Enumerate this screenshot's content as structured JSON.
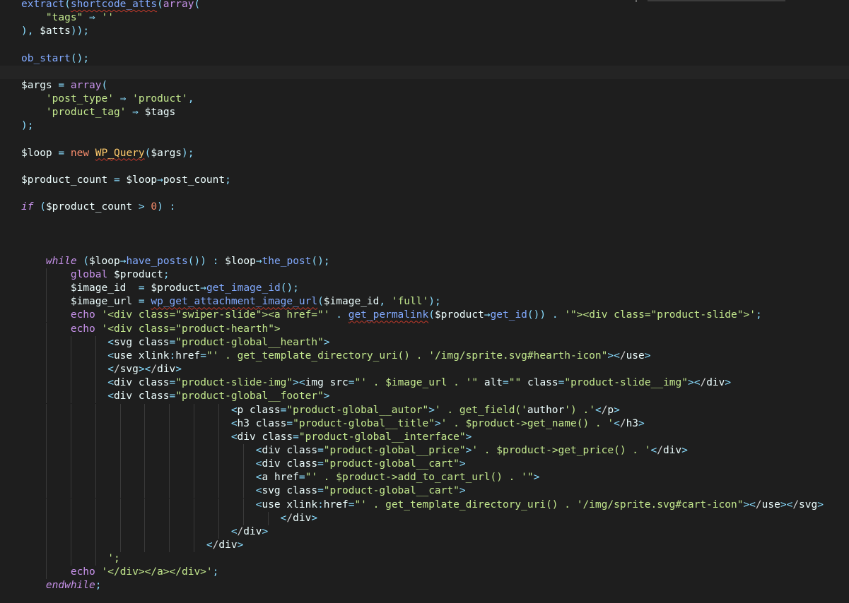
{
  "editor": {
    "language": "php",
    "lines": [
      "extract(shortcode_atts(array(",
      "    \"tags\" => ''",
      "), $atts));",
      "",
      "ob_start();",
      "",
      "$args = array(",
      "    'post_type' => 'product',",
      "    'product_tag' => $tags",
      ");",
      "",
      "$loop = new WP_Query($args);",
      "",
      "$product_count = $loop->post_count;",
      "",
      "if ($product_count > 0) :",
      "",
      "",
      "",
      "    while ($loop->have_posts()) : $loop->the_post();",
      "        global $product;",
      "        $image_id  = $product->get_image_id();",
      "        $image_url = wp_get_attachment_image_url($image_id, 'full');",
      "        echo '<div class=\"swiper-slide\"><a href=\"' . get_permalink($product->get_id()) . '\"><div class=\"product-slide\">';",
      "        echo '<div class=\"product-hearth\">",
      "              <svg class=\"product-global__hearth\">",
      "              <use xlink:href=\"' . get_template_directory_uri() . '/img/sprite.svg#hearth-icon\"></use>",
      "              </svg></div>",
      "              <div class=\"product-slide-img\"><img src=\"' . $image_url . '\" alt=\"\" class=\"product-slide__img\"></div>",
      "              <div class=\"product-global__footer\">",
      "                                  <p class=\"product-global__autor\">' . get_field('author') .'</p>",
      "                                  <h3 class=\"product-global__title\">' . $product->get_name() . '</h3>",
      "                                  <div class=\"product-global__interface\">",
      "                                      <div class=\"product-global__price\">' . $product->get_price() . '</div>",
      "                                      <div class=\"product-global__cart\">",
      "                                      <a href=\"' . $product->add_to_cart_url() . '\">",
      "                                      <svg class=\"product-global__cart\">",
      "                                      <use xlink:href=\"' . get_template_directory_uri() . '/img/sprite.svg#cart-icon\"></use></svg>",
      "                                          </div>",
      "                                  </div>",
      "                              </div>",
      "              ';",
      "        echo '</div></a></div>';",
      "    endwhile;"
    ]
  }
}
